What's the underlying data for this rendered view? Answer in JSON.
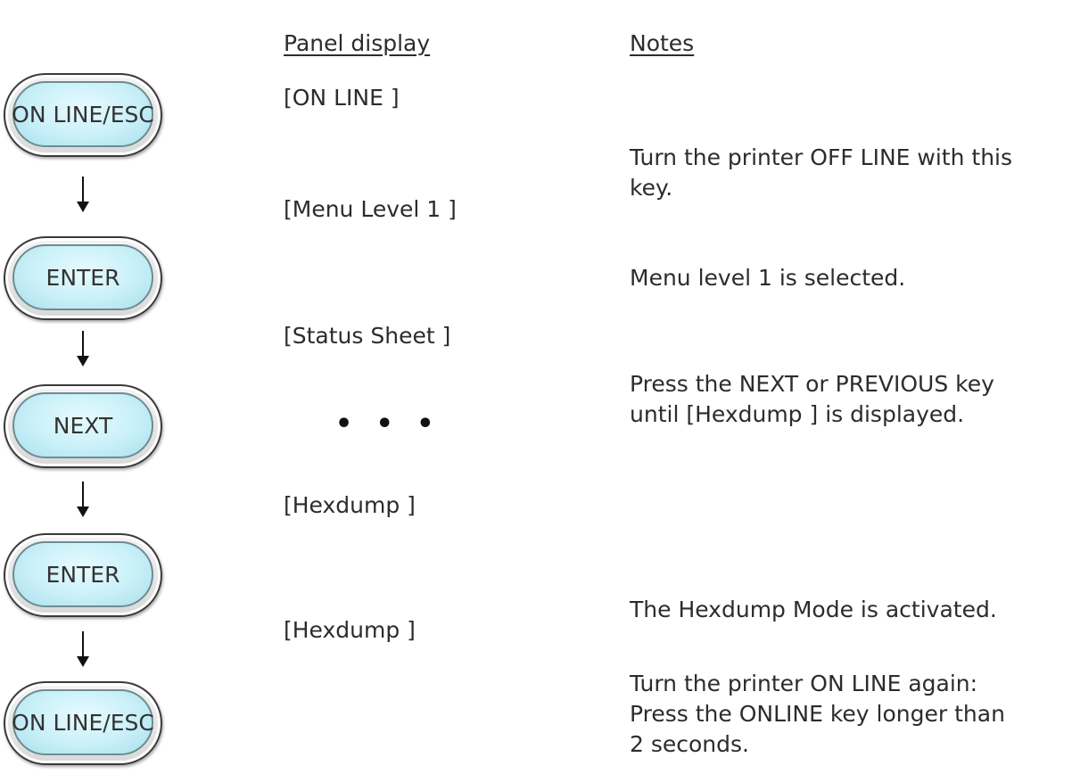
{
  "headers": {
    "panel_display": "Panel display",
    "notes": "Notes"
  },
  "keys": [
    {
      "label": "ON LINE/ESC"
    },
    {
      "label": "ENTER"
    },
    {
      "label": "NEXT"
    },
    {
      "label": "ENTER"
    },
    {
      "label": "ON LINE/ESC"
    }
  ],
  "panel": {
    "on_line": "[ON LINE ]",
    "menu_level": "[Menu Level 1 ]",
    "status_sheet": "[Status Sheet ]",
    "ellipsis": "• • •",
    "hexdump_1": "[Hexdump ]",
    "hexdump_2": "[Hexdump ]"
  },
  "notes": {
    "n1_line1": "Turn the printer OFF LINE with this",
    "n1_line2": "key.",
    "n2": "Menu level 1 is selected.",
    "n3_line1": "Press the NEXT or PREVIOUS key",
    "n3_line2": "until [Hexdump ] is displayed.",
    "n4": "The Hexdump Mode is activated.",
    "n5_line1": "Turn the printer ON LINE again:",
    "n5_line2": "Press the ONLINE key longer than",
    "n5_line3": "2 seconds."
  }
}
